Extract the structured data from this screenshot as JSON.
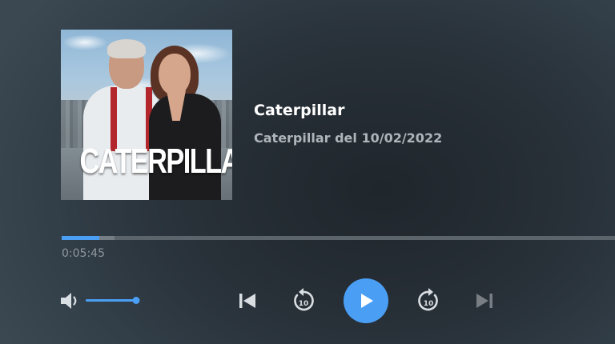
{
  "episode": {
    "artwork_title": "CATERPILLAR",
    "title": "Caterpillar",
    "subtitle": "Caterpillar del 10/02/2022"
  },
  "playback": {
    "current_time": "0:05:45",
    "progress_fraction": 0.068,
    "buffered_fraction": 0.095,
    "volume_fraction": 0.95,
    "state": "paused"
  },
  "controls": {
    "rewind_seconds": "10",
    "forward_seconds": "10",
    "next_enabled": false
  },
  "colors": {
    "accent": "#4a9ff5",
    "title": "#ffffff",
    "subtitle": "#aeb5bb",
    "time": "#8f979d"
  },
  "icons": [
    "volume-icon",
    "skip-previous-icon",
    "rewind-10-icon",
    "play-icon",
    "forward-10-icon",
    "skip-next-icon"
  ]
}
